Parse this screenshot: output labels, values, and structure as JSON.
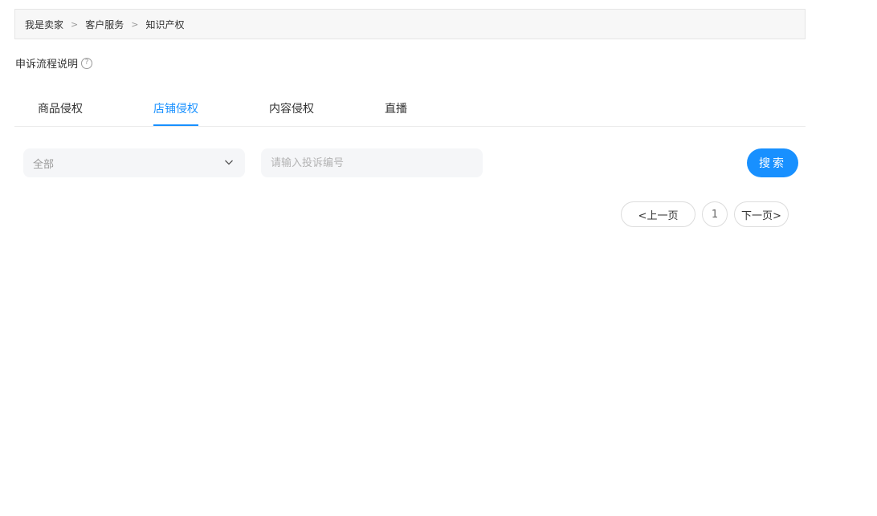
{
  "breadcrumb": {
    "items": [
      "我是卖家",
      "客户服务",
      "知识产权"
    ],
    "separator": ">"
  },
  "help": {
    "label": "申诉流程说明",
    "icon": "question-circle-icon",
    "icon_glyph": "?"
  },
  "tabs": [
    {
      "label": "商品侵权",
      "active": false
    },
    {
      "label": "店铺侵权",
      "active": true
    },
    {
      "label": "内容侵权",
      "active": false
    },
    {
      "label": "直播",
      "active": false
    }
  ],
  "filters": {
    "select_value": "全部",
    "search_placeholder": "请输入投诉编号",
    "search_button": "搜索"
  },
  "pagination": {
    "prev_label": "<上一页",
    "current_page": "1",
    "next_label": "下一页>"
  },
  "colors": {
    "accent": "#1890ff",
    "input_bg": "#f5f6f8",
    "breadcrumb_bg": "#f7f7f7"
  }
}
